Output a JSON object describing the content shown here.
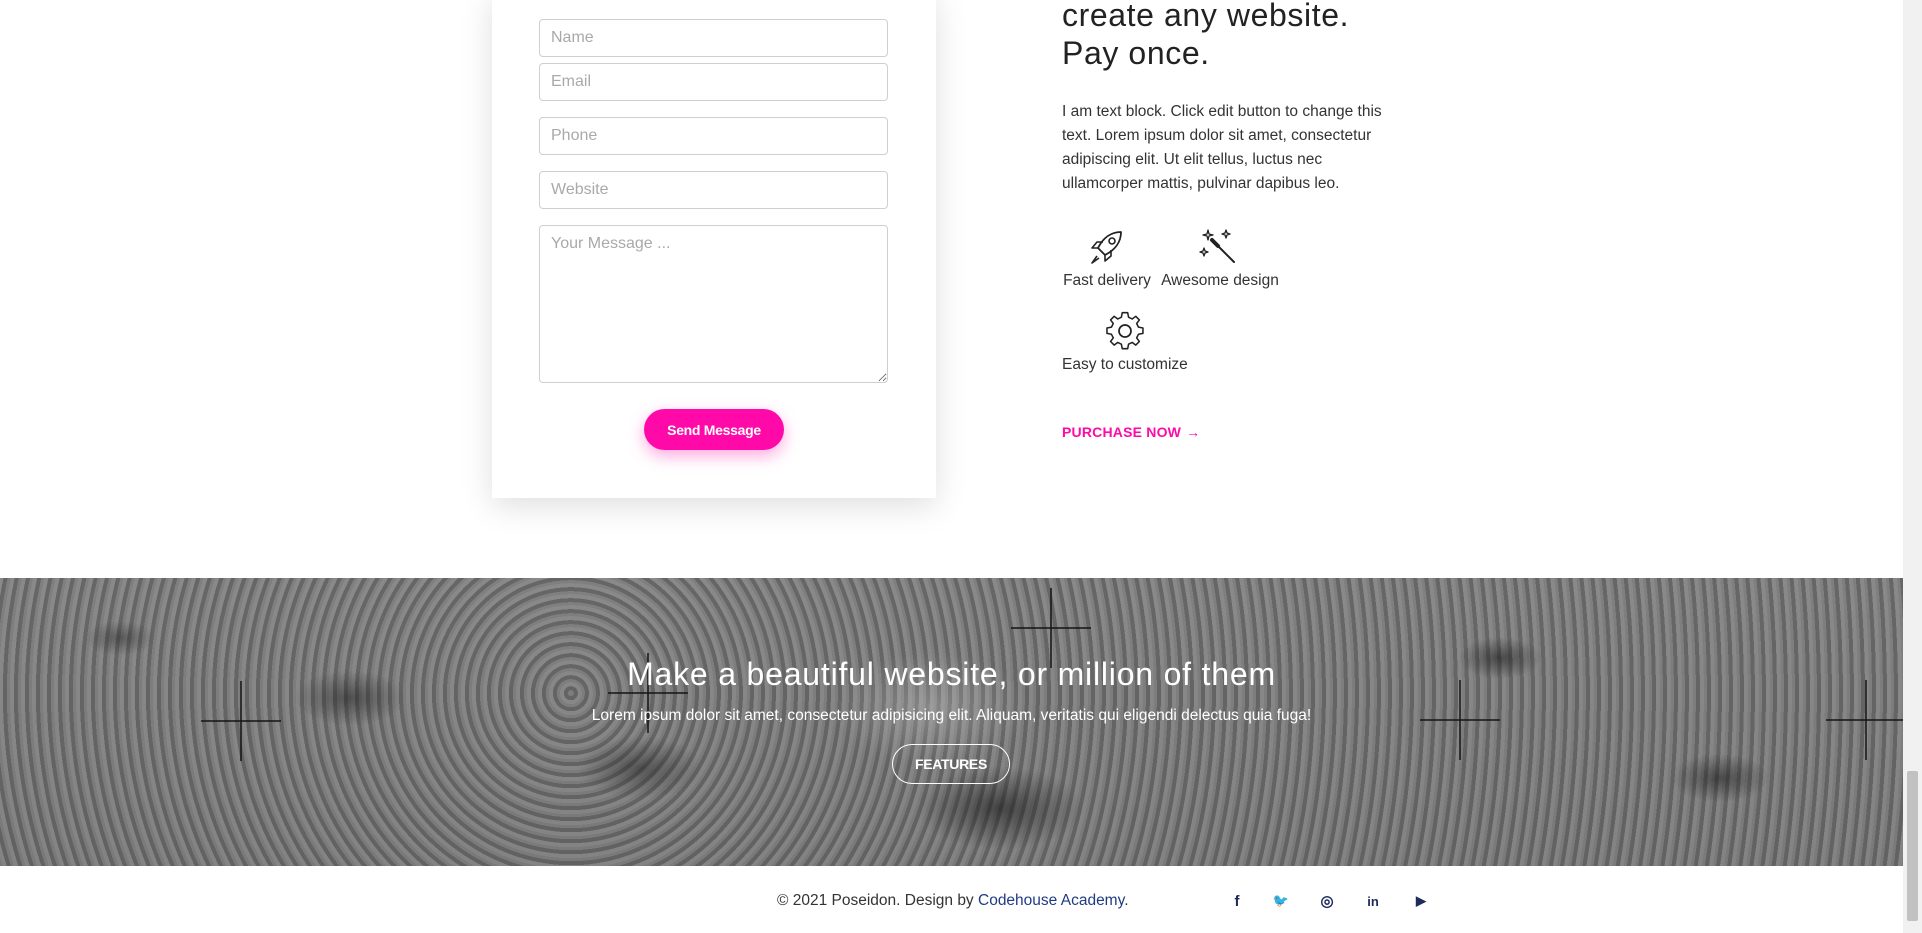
{
  "contact_form": {
    "name_placeholder": "Name",
    "email_placeholder": "Email",
    "phone_placeholder": "Phone",
    "website_placeholder": "Website",
    "message_placeholder": "Your Message ...",
    "send_label": "Send Message"
  },
  "info": {
    "headline_line1": "create any website.",
    "headline_line2": "Pay once.",
    "body": "I am text block. Click edit button to change this text. Lorem ipsum dolor sit amet, consectetur adipiscing elit. Ut elit tellus, luctus nec ullamcorper mattis, pulvinar dapibus leo.",
    "features": [
      {
        "label": "Fast delivery",
        "icon": "rocket-icon"
      },
      {
        "label": "Awesome design",
        "icon": "magic-wand-icon"
      },
      {
        "label": "Easy to customize",
        "icon": "gear-icon"
      }
    ],
    "purchase_label": "PURCHASE NOW",
    "purchase_arrow": "→"
  },
  "banner": {
    "title": "Make a beautiful website, or million of them",
    "subtitle": "Lorem ipsum dolor sit amet, consectetur adipisicing elit. Aliquam, veritatis qui eligendi delectus quia fuga!",
    "button_label": "FEATURES"
  },
  "footer": {
    "copyright_prefix": "© 2021 Poseidon. Design by ",
    "link_text": "Codehouse Academy",
    "suffix": ".",
    "social": [
      {
        "icon": "facebook-icon",
        "glyph": "f"
      },
      {
        "icon": "twitter-icon",
        "glyph": "🐦"
      },
      {
        "icon": "instagram-icon",
        "glyph": "◎"
      },
      {
        "icon": "linkedin-icon",
        "glyph": "in"
      },
      {
        "icon": "youtube-icon",
        "glyph": "▶"
      }
    ]
  },
  "colors": {
    "accent": "#ff0aa8",
    "footer_link": "#1f3b82",
    "social_icon": "#1f2a5c"
  }
}
